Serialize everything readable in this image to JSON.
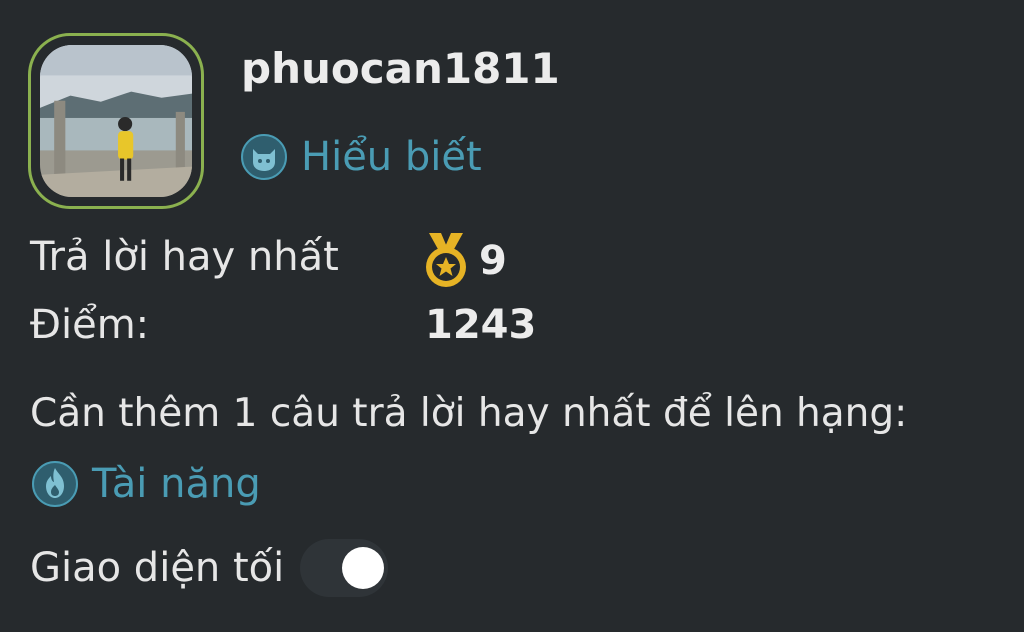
{
  "profile": {
    "username": "phuocan1811",
    "rank_label": "Hiểu biết",
    "rank_icon": "cat-badge-icon"
  },
  "stats": {
    "best_answers_label": "Trả lời hay nhất",
    "best_answers_value": "9",
    "points_label": "Điểm:",
    "points_value": "1243"
  },
  "progress": {
    "text": "Cần thêm 1 câu trả lời hay nhất để lên hạng:",
    "next_rank_label": "Tài năng",
    "next_rank_icon": "flame-badge-icon"
  },
  "settings": {
    "dark_mode_label": "Giao diện tối",
    "dark_mode_on": true
  },
  "colors": {
    "background": "#262a2d",
    "rank_accent": "#4a9cb4",
    "avatar_border": "#8bb14f",
    "medal": "#e6b325"
  }
}
